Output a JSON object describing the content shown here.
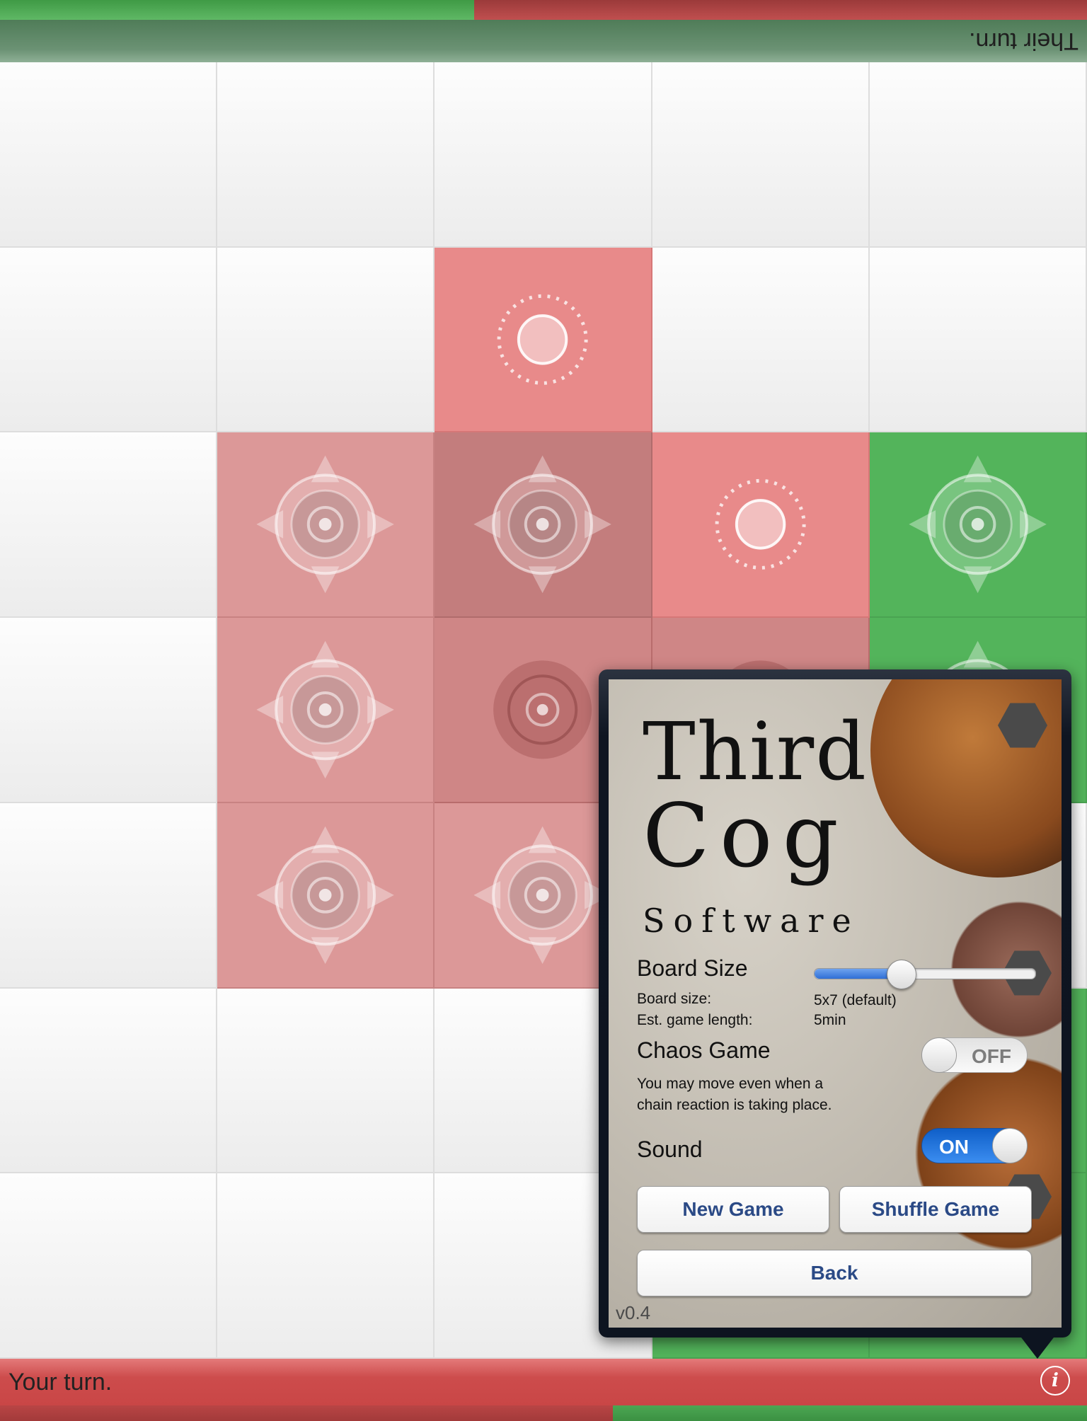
{
  "opponent": {
    "status_text": "Their turn."
  },
  "player": {
    "status_text": "Your turn."
  },
  "board": {
    "rows": 7,
    "cols": 5,
    "cells": [
      [
        "empty",
        "empty",
        "empty",
        "empty",
        "empty"
      ],
      [
        "empty",
        "empty",
        "pink-1",
        "empty",
        "empty"
      ],
      [
        "empty",
        "rosy-3",
        "rosy-dark-3",
        "pink-1",
        "green-3"
      ],
      [
        "empty",
        "rosy-3",
        "red-dark-2",
        "red-dark-2",
        "green-3"
      ],
      [
        "empty",
        "rosy-3",
        "rosy-3",
        "empty",
        "empty"
      ],
      [
        "empty",
        "empty",
        "empty",
        "green",
        "green"
      ],
      [
        "empty",
        "empty",
        "empty",
        "green",
        "green"
      ]
    ]
  },
  "colors": {
    "player_red": "#c94646",
    "opponent_green": "#53b45b",
    "button_text": "#2b4a86"
  },
  "menu": {
    "logo_line1": "Third",
    "logo_line2": "Cog",
    "logo_line3": "Software",
    "board_size": {
      "label": "Board Size",
      "slider_fraction": 0.39,
      "size_label": "Board size:",
      "size_value": "5x7 (default)",
      "length_label": "Est. game length:",
      "length_value": "5min"
    },
    "chaos_game": {
      "label": "Chaos Game",
      "toggle_text": "OFF",
      "description_line1": "You may move even when a",
      "description_line2": "chain reaction is taking place."
    },
    "sound": {
      "label": "Sound",
      "toggle_text": "ON"
    },
    "buttons": {
      "new_game": "New Game",
      "shuffle_game": "Shuffle Game",
      "back": "Back"
    },
    "version": "v0.4"
  },
  "icons": {
    "info": "info-icon"
  }
}
